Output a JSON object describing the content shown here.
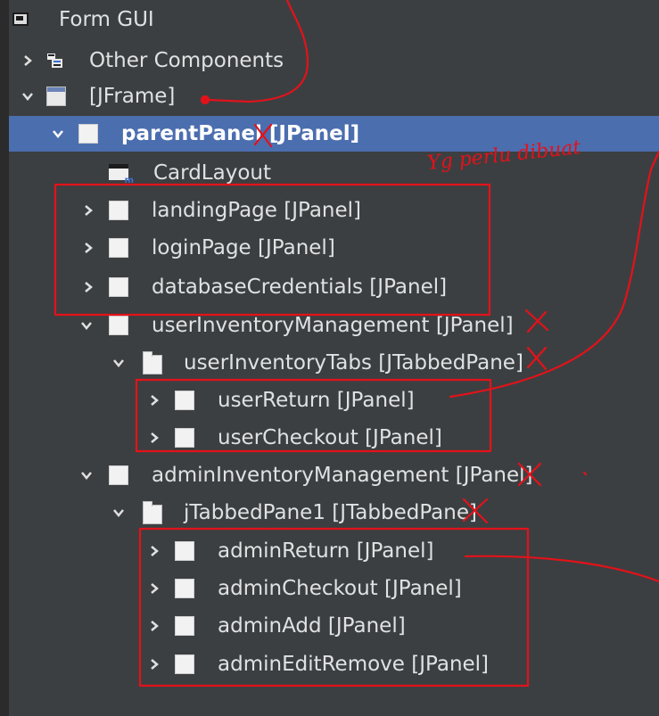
{
  "tree": {
    "items": [
      {
        "label": "Form GUI"
      },
      {
        "label": "Other Components"
      },
      {
        "label": "[JFrame]"
      },
      {
        "label": "parentPanel [JPanel]"
      },
      {
        "label": "CardLayout"
      },
      {
        "label": "landingPage [JPanel]"
      },
      {
        "label": "loginPage [JPanel]"
      },
      {
        "label": "databaseCredentials [JPanel]"
      },
      {
        "label": "userInventoryManagement [JPanel]"
      },
      {
        "label": "userInventoryTabs [JTabbedPane]"
      },
      {
        "label": "userReturn [JPanel]"
      },
      {
        "label": "userCheckout [JPanel]"
      },
      {
        "label": "adminInventoryManagement [JPanel]"
      },
      {
        "label": "jTabbedPane1 [JTabbedPane]"
      },
      {
        "label": "adminReturn [JPanel]"
      },
      {
        "label": "adminCheckout [JPanel]"
      },
      {
        "label": "adminAdd [JPanel]"
      },
      {
        "label": "adminEditRemove [JPanel]"
      }
    ]
  },
  "annotations": {
    "note": "Yg perlu dibuat"
  },
  "colors": {
    "background": "#3c3f41",
    "selection": "#4b6eaf",
    "annotation": "#e3121a"
  },
  "icons": {
    "expand": "chevron-right-icon",
    "collapse": "chevron-down-icon",
    "panel": "panel-icon",
    "frame": "frame-icon",
    "tabbed": "tabbed-pane-icon",
    "form": "form-icon",
    "other": "other-components-icon",
    "layout": "card-layout-icon"
  }
}
